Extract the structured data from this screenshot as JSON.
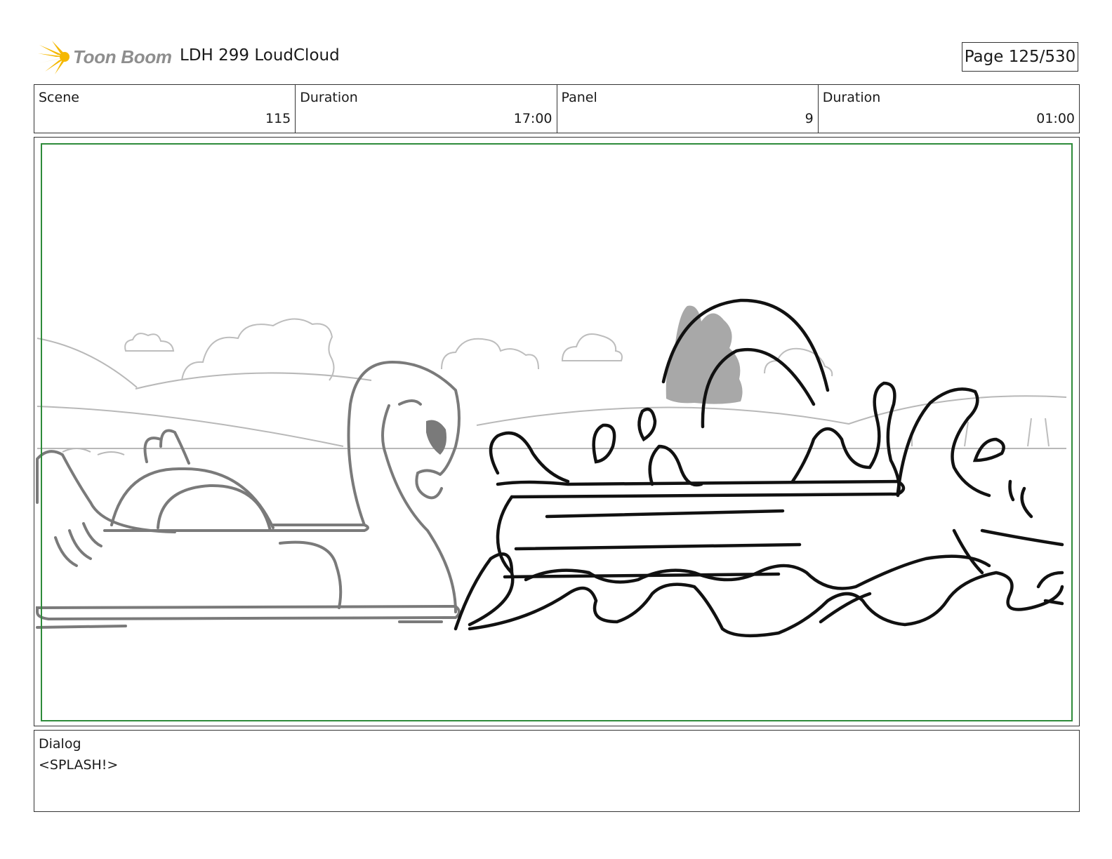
{
  "header": {
    "logo_text": "Toon Boom",
    "project_title": "LDH 299 LoudCloud",
    "page_label": "Page 125/530"
  },
  "info": {
    "scene_label": "Scene",
    "scene_value": "115",
    "scene_duration_label": "Duration",
    "scene_duration_value": "17:00",
    "panel_label": "Panel",
    "panel_value": "9",
    "panel_duration_label": "Duration",
    "panel_duration_value": "01:00"
  },
  "panel": {
    "safe_frame_color": "#2e8b3a",
    "drawing_subject": "swan-boat-and-splash-sketch"
  },
  "dialog": {
    "label": "Dialog",
    "text": "<SPLASH!>"
  },
  "colors": {
    "logo_star": "#f5b800",
    "logo_text": "#8e8e8e"
  }
}
